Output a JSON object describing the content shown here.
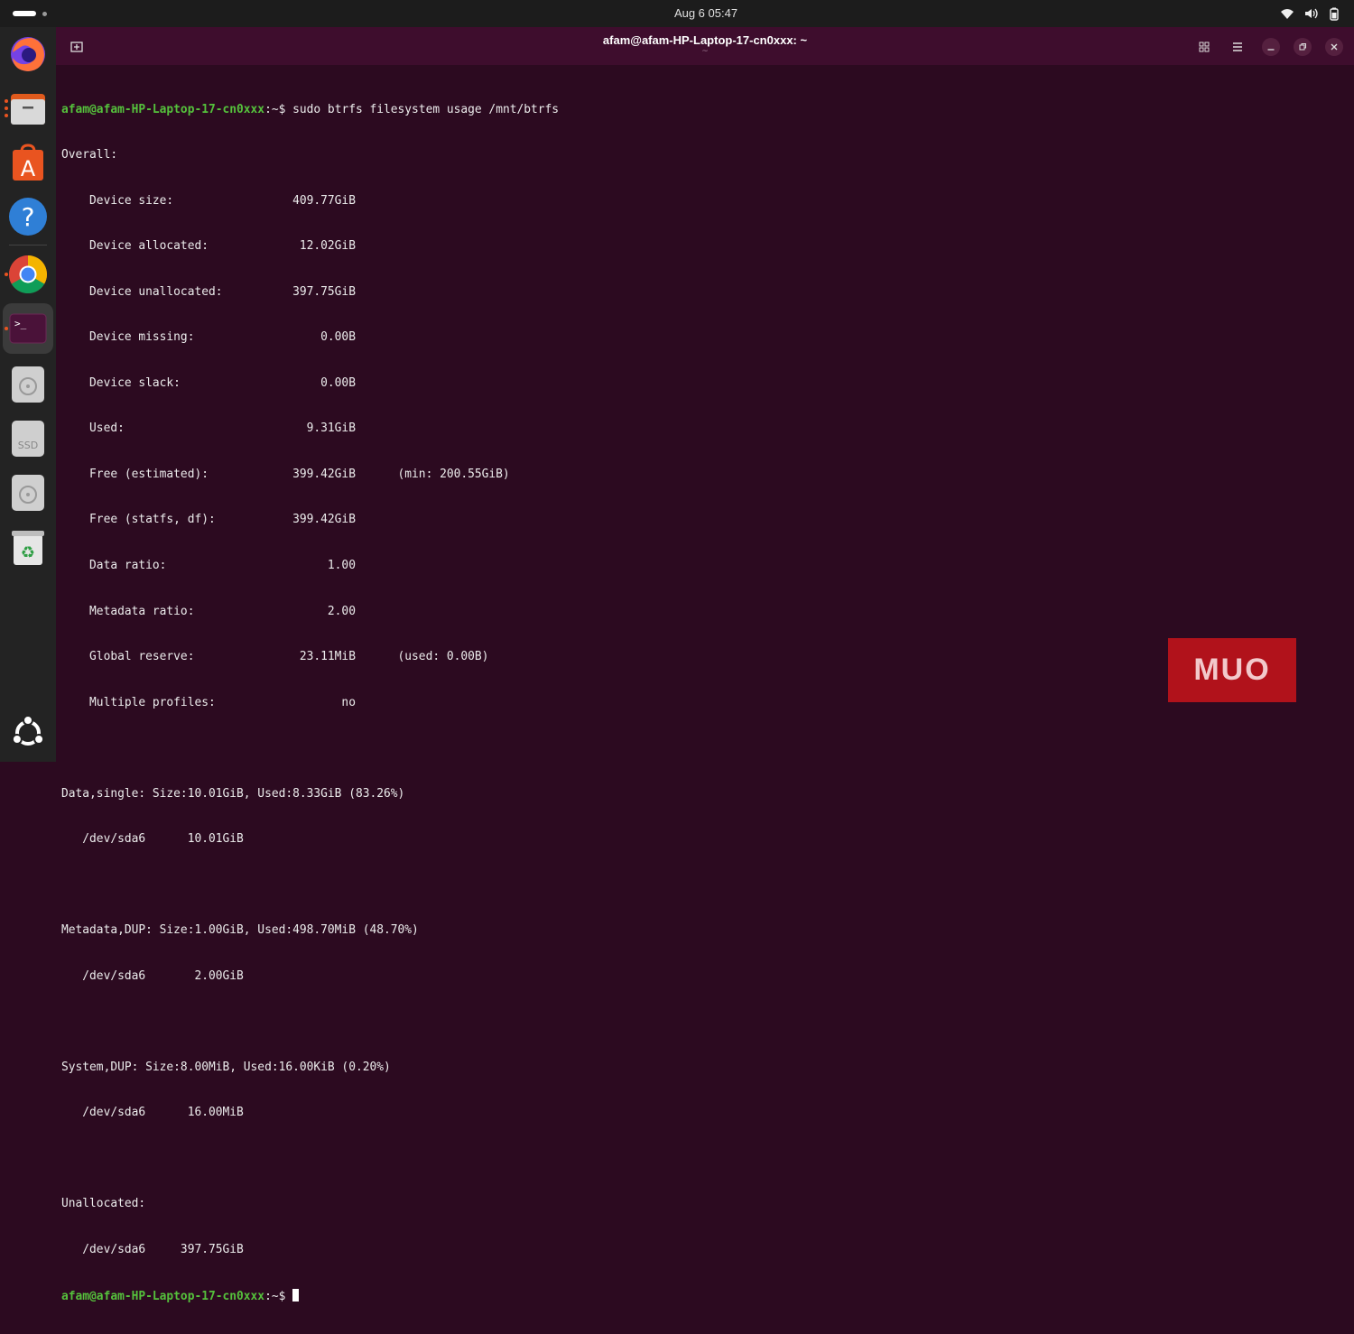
{
  "topbar": {
    "datetime": "Aug 6  05:47"
  },
  "window": {
    "title": "afam@afam-HP-Laptop-17-cn0xxx: ~",
    "subtitle": "~"
  },
  "terminal": {
    "prompt_user_host": "afam@afam-HP-Laptop-17-cn0xxx",
    "prompt_suffix": ":~$ ",
    "command": "sudo btrfs filesystem usage /mnt/btrfs",
    "lines": [
      "Overall:",
      "    Device size:                 409.77GiB",
      "    Device allocated:             12.02GiB",
      "    Device unallocated:          397.75GiB",
      "    Device missing:                  0.00B",
      "    Device slack:                    0.00B",
      "    Used:                          9.31GiB",
      "    Free (estimated):            399.42GiB      (min: 200.55GiB)",
      "    Free (statfs, df):           399.42GiB",
      "    Data ratio:                       1.00",
      "    Metadata ratio:                   2.00",
      "    Global reserve:               23.11MiB      (used: 0.00B)",
      "    Multiple profiles:                  no",
      "",
      "Data,single: Size:10.01GiB, Used:8.33GiB (83.26%)",
      "   /dev/sda6      10.01GiB",
      "",
      "Metadata,DUP: Size:1.00GiB, Used:498.70MiB (48.70%)",
      "   /dev/sda6       2.00GiB",
      "",
      "System,DUP: Size:8.00MiB, Used:16.00KiB (0.20%)",
      "   /dev/sda6      16.00MiB",
      "",
      "Unallocated:",
      "   /dev/sda6     397.75GiB"
    ]
  },
  "dock": [
    "firefox-icon",
    "files-icon",
    "app-center-icon",
    "help-icon",
    "chrome-icon",
    "terminal-icon",
    "disk-icon",
    "ssd-icon",
    "disk-icon",
    "trash-icon",
    "show-apps-icon"
  ],
  "watermark": {
    "text": "MUO"
  },
  "colors": {
    "terminal_bg": "#2c0a20",
    "titlebar": "#3e0d2d",
    "prompt": "#55c13c",
    "logo": "#b1121b"
  }
}
